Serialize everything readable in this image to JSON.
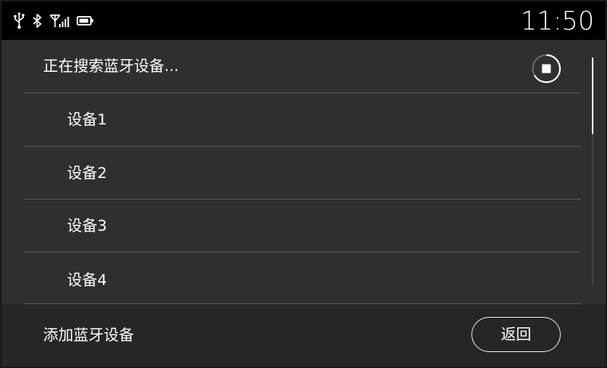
{
  "status_bar": {
    "icons": [
      "usb-icon",
      "bluetooth-icon",
      "signal-icon",
      "battery-icon"
    ],
    "time": "11:50"
  },
  "search": {
    "status_text": "正在搜索蓝牙设备...",
    "stop_icon": "stop-icon"
  },
  "devices": [
    {
      "label": "设备1"
    },
    {
      "label": "设备2"
    },
    {
      "label": "设备3"
    },
    {
      "label": "设备4"
    }
  ],
  "footer": {
    "add_label": "添加蓝牙设备",
    "back_label": "返回"
  },
  "colors": {
    "status_bar_bg": "#000000",
    "list_bg": "#2f2f2f",
    "footer_bg": "#262626",
    "divider": "#5a5a5a",
    "text": "#ffffff"
  }
}
